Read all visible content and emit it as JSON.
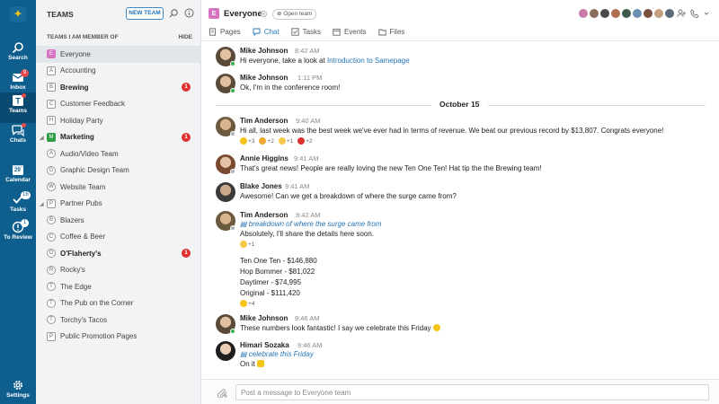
{
  "rail": {
    "items": [
      {
        "label": "Search",
        "icon": "search-icon"
      },
      {
        "label": "Inbox",
        "icon": "inbox-icon",
        "badge": "9"
      },
      {
        "label": "Teams",
        "icon": "teams-icon"
      },
      {
        "label": "Chats",
        "icon": "chat-icon"
      },
      {
        "label": "Calendar",
        "icon": "calendar-icon",
        "badge": "29"
      },
      {
        "label": "Tasks",
        "icon": "tasks-icon",
        "badge": "16"
      },
      {
        "label": "To Review",
        "icon": "review-icon",
        "badge": "1"
      },
      {
        "label": "Settings",
        "icon": "gear-icon"
      }
    ]
  },
  "teams_panel": {
    "title": "TEAMS",
    "new_team_label": "NEW TEAM",
    "member_of_label": "TEAMS I AM MEMBER OF",
    "hide_label": "HIDE",
    "items": [
      {
        "label": "Everyone",
        "initial": "E"
      },
      {
        "label": "Accounting",
        "initial": "A"
      },
      {
        "label": "Brewing",
        "initial": "B",
        "badge": "1"
      },
      {
        "label": "Customer Feedback",
        "initial": "C"
      },
      {
        "label": "Holiday Party",
        "initial": "H"
      },
      {
        "label": "Marketing",
        "initial": "M",
        "badge": "1"
      },
      {
        "label": "Audio/Video Team",
        "initial": "A"
      },
      {
        "label": "Graphic Design Team",
        "initial": "G"
      },
      {
        "label": "Website Team",
        "initial": "W"
      },
      {
        "label": "Partner Pubs",
        "initial": "P"
      },
      {
        "label": "Blazers",
        "initial": "B"
      },
      {
        "label": "Coffee & Beer",
        "initial": "C"
      },
      {
        "label": "O'Flaherty's",
        "initial": "O",
        "badge": "1"
      },
      {
        "label": "Rocky's",
        "initial": "R"
      },
      {
        "label": "The Edge",
        "initial": "T"
      },
      {
        "label": "The Pub on the Corner",
        "initial": "T"
      },
      {
        "label": "Torchy's Tacos",
        "initial": "T"
      },
      {
        "label": "Public Promotion Pages",
        "initial": "P"
      }
    ]
  },
  "channel": {
    "initial": "E",
    "title": "Everyone",
    "open_team_label": "Open team",
    "tabs": [
      "Pages",
      "Chat",
      "Tasks",
      "Events",
      "Files"
    ],
    "active_tab": "Chat",
    "member_colors": [
      "#c97aa8",
      "#8a6d5a",
      "#4a4a4a",
      "#b07050",
      "#3d5a4a",
      "#6a8fb0",
      "#7a5040",
      "#c4a080",
      "#5a6a7a"
    ]
  },
  "messages": [
    {
      "name": "Mike Johnson",
      "time": "8:42 AM",
      "lines": [
        "Hi everyone, take a look at "
      ],
      "link": "Introduction to Samepage"
    },
    {
      "name": "Mike Johnson",
      "time": "1:11 PM",
      "lines": [
        "Ok, I'm in the conference room!"
      ]
    },
    {
      "date": "October 15"
    },
    {
      "name": "Tim Anderson",
      "time": "9:40 AM",
      "lines": [
        "Hi all, last week was the best week we've ever had in terms of revenue. We beat our previous record by $13,807. Congrats everyone!"
      ],
      "reactions": [
        "+3",
        "+2",
        "+1",
        "+2"
      ]
    },
    {
      "name": "Annie Higgins",
      "time": "9:41 AM",
      "lines": [
        "That's great news! People are really loving the new Ten One Ten! Hat tip the the Brewing team!"
      ]
    },
    {
      "name": "Blake Jones",
      "time": "9:41 AM",
      "lines": [
        "Awesome!  Can we get a breakdown of where the surge came from?"
      ]
    },
    {
      "name": "Tim Anderson",
      "time": "9:42 AM",
      "quote": "breakdown of where the surge came from",
      "lines": [
        "Absolutely, I'll share the details here soon.",
        "Ten One Ten - $146,880",
        "Hop Bommer - $81,022",
        "Daytimer - $74,995",
        "Original - $111,420"
      ],
      "reactions_a": [
        "+1"
      ],
      "reactions_b": [
        "+4"
      ]
    },
    {
      "name": "Mike Johnson",
      "time": "9:46 AM",
      "lines": [
        "These numbers look fantastic!  I say we celebrate this Friday"
      ]
    },
    {
      "name": "Himari Sozaka",
      "time": "9:46 AM",
      "quote": "celebrate this Friday",
      "lines": [
        "On it"
      ]
    }
  ],
  "composer": {
    "placeholder": "Post a message to Everyone team"
  }
}
